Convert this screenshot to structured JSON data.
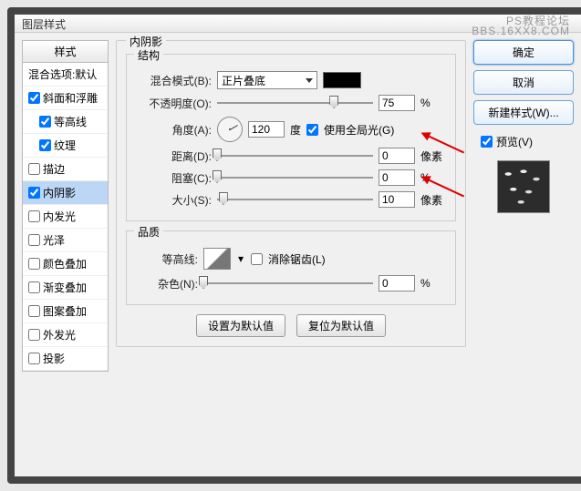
{
  "window": {
    "title": "图层样式"
  },
  "watermark": {
    "line1": "PS教程论坛",
    "line2": "BBS.16XX8.COM"
  },
  "styles": {
    "header": "样式",
    "items": [
      {
        "label": "混合选项:默认",
        "checked": null,
        "sub": false
      },
      {
        "label": "斜面和浮雕",
        "checked": true,
        "sub": false
      },
      {
        "label": "等高线",
        "checked": true,
        "sub": true
      },
      {
        "label": "纹理",
        "checked": true,
        "sub": true
      },
      {
        "label": "描边",
        "checked": false,
        "sub": false
      },
      {
        "label": "内阴影",
        "checked": true,
        "sub": false,
        "selected": true
      },
      {
        "label": "内发光",
        "checked": false,
        "sub": false
      },
      {
        "label": "光泽",
        "checked": false,
        "sub": false
      },
      {
        "label": "颜色叠加",
        "checked": false,
        "sub": false
      },
      {
        "label": "渐变叠加",
        "checked": false,
        "sub": false
      },
      {
        "label": "图案叠加",
        "checked": false,
        "sub": false
      },
      {
        "label": "外发光",
        "checked": false,
        "sub": false
      },
      {
        "label": "投影",
        "checked": false,
        "sub": false
      }
    ]
  },
  "panel": {
    "title": "内阴影",
    "structure": {
      "title": "结构",
      "blend_mode_label": "混合模式(B):",
      "blend_mode_value": "正片叠底",
      "opacity_label": "不透明度(O):",
      "opacity_value": "75",
      "opacity_unit": "%",
      "angle_label": "角度(A):",
      "angle_value": "120",
      "angle_unit": "度",
      "global_light_label": "使用全局光(G)",
      "global_light_checked": true,
      "distance_label": "距离(D):",
      "distance_value": "0",
      "distance_unit": "像素",
      "choke_label": "阻塞(C):",
      "choke_value": "0",
      "choke_unit": "%",
      "size_label": "大小(S):",
      "size_value": "10",
      "size_unit": "像素"
    },
    "quality": {
      "title": "品质",
      "contour_label": "等高线:",
      "antialias_label": "消除锯齿(L)",
      "antialias_checked": false,
      "noise_label": "杂色(N):",
      "noise_value": "0",
      "noise_unit": "%"
    },
    "buttons": {
      "make_default": "设置为默认值",
      "reset_default": "复位为默认值"
    }
  },
  "right": {
    "ok": "确定",
    "cancel": "取消",
    "new_style": "新建样式(W)...",
    "preview_label": "预览(V)",
    "preview_checked": true
  }
}
